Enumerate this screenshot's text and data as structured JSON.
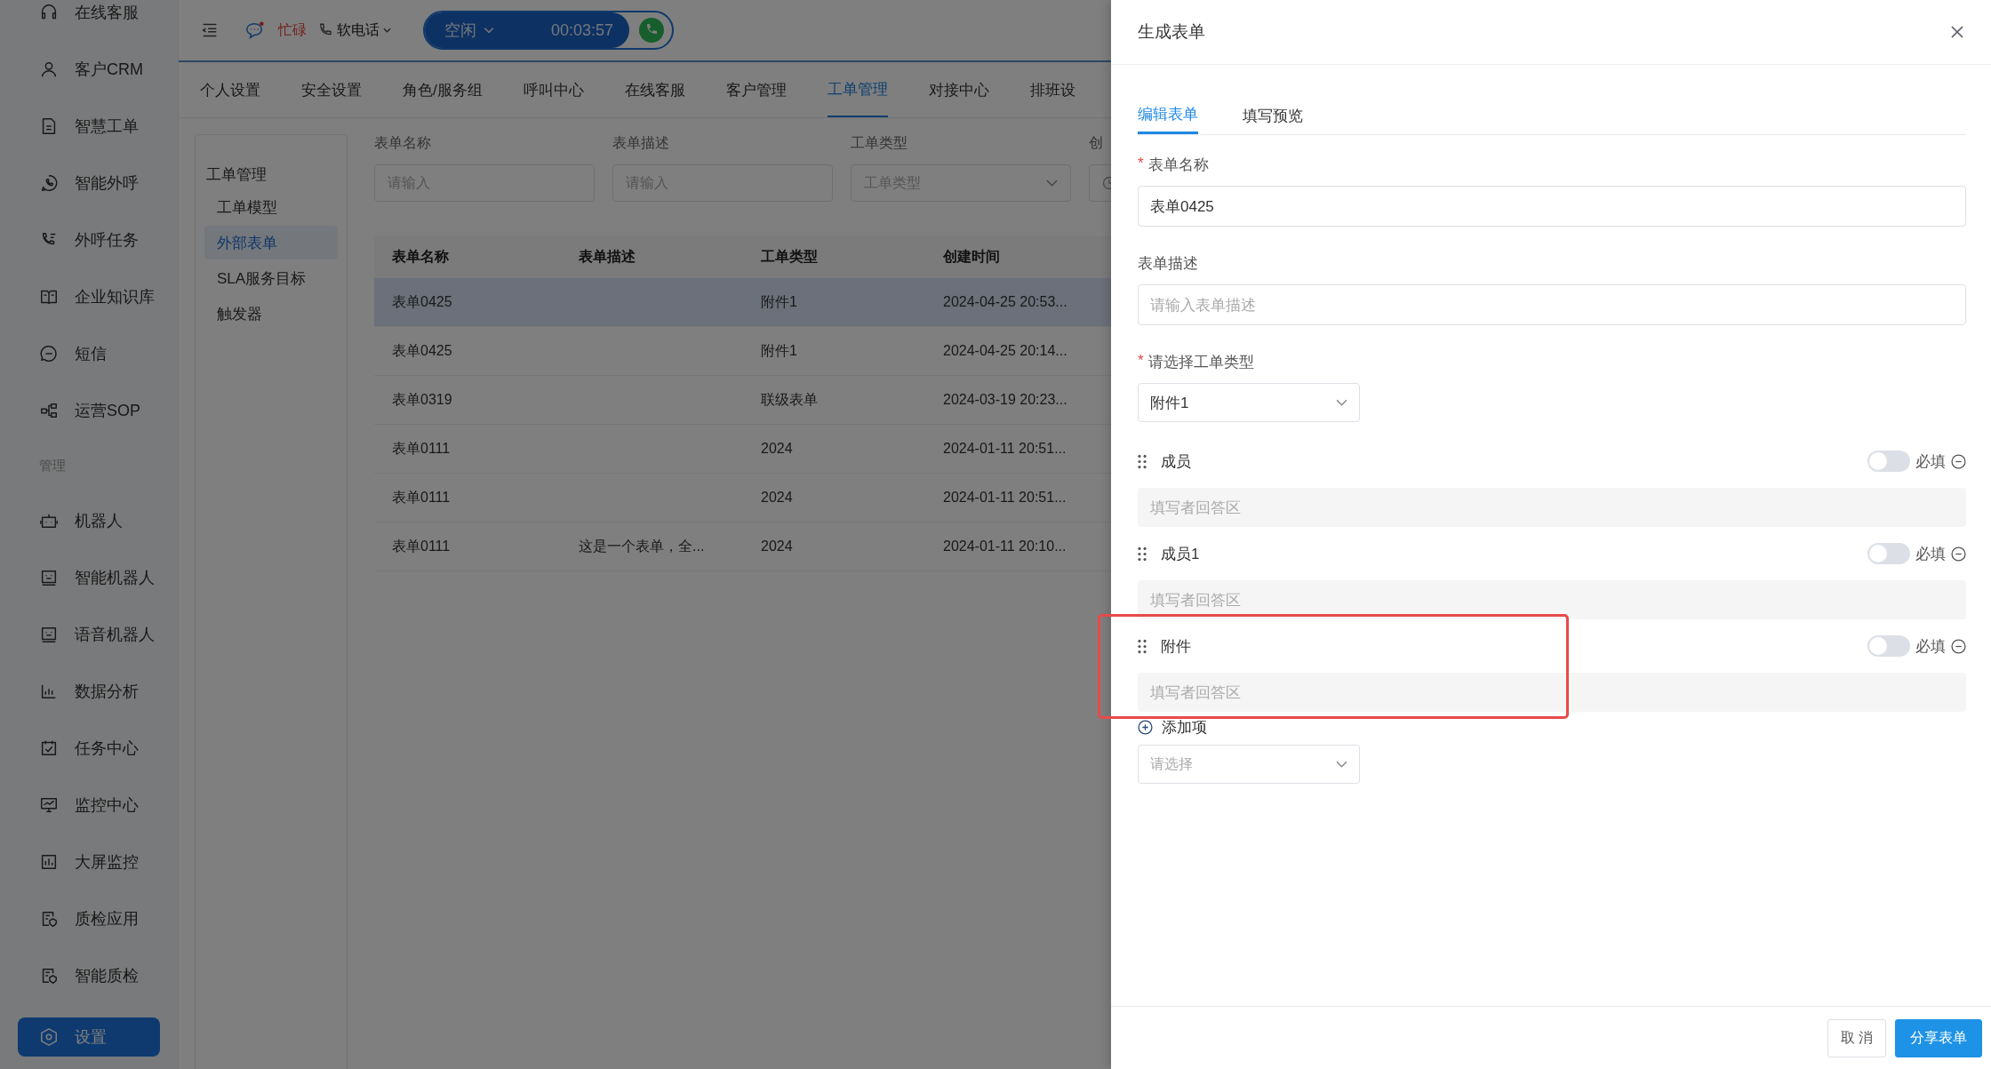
{
  "sidebar": {
    "items": [
      {
        "label": "在线客服",
        "selected": false
      },
      {
        "label": "客户CRM",
        "selected": false
      },
      {
        "label": "智慧工单",
        "selected": false
      },
      {
        "label": "智能外呼",
        "selected": false
      },
      {
        "label": "外呼任务",
        "selected": false
      },
      {
        "label": "企业知识库",
        "selected": false
      },
      {
        "label": "短信",
        "selected": false
      },
      {
        "label": "运营SOP",
        "selected": false
      }
    ],
    "section": "管理",
    "admin_items": [
      {
        "label": "机器人",
        "selected": false
      },
      {
        "label": "智能机器人",
        "selected": false
      },
      {
        "label": "语音机器人",
        "selected": false
      },
      {
        "label": "数据分析",
        "selected": false
      },
      {
        "label": "任务中心",
        "selected": false
      },
      {
        "label": "监控中心",
        "selected": false
      },
      {
        "label": "大屏监控",
        "selected": false
      },
      {
        "label": "质检应用",
        "selected": false
      },
      {
        "label": "智能质检",
        "selected": false
      },
      {
        "label": "设置",
        "selected": true
      }
    ]
  },
  "top_bar": {
    "status": "忙碌",
    "softphone": "软电话",
    "call_state": "空闲",
    "timer": "00:03:57"
  },
  "settings_tabs": [
    {
      "label": "个人设置",
      "selected": false
    },
    {
      "label": "安全设置",
      "selected": false
    },
    {
      "label": "角色/服务组",
      "selected": false
    },
    {
      "label": "呼叫中心",
      "selected": false
    },
    {
      "label": "在线客服",
      "selected": false
    },
    {
      "label": "客户管理",
      "selected": false
    },
    {
      "label": "工单管理",
      "selected": true
    },
    {
      "label": "对接中心",
      "selected": false
    },
    {
      "label": "排班设",
      "selected": false
    }
  ],
  "subnav": {
    "title": "工单管理",
    "items": [
      {
        "label": "工单模型",
        "selected": false
      },
      {
        "label": "外部表单",
        "selected": true
      },
      {
        "label": "SLA服务目标",
        "selected": false
      },
      {
        "label": "触发器",
        "selected": false
      }
    ]
  },
  "filters": [
    {
      "kind": "input",
      "label": "表单名称",
      "placeholder": "请输入"
    },
    {
      "kind": "input",
      "label": "表单描述",
      "placeholder": "请输入"
    },
    {
      "kind": "select",
      "label": "工单类型",
      "placeholder": "工单类型"
    },
    {
      "kind": "date",
      "label": "创"
    }
  ],
  "table": {
    "columns": [
      "表单名称",
      "表单描述",
      "工单类型",
      "创建时间"
    ],
    "rows": [
      {
        "selected": true,
        "cells": [
          "表单0425",
          "",
          "附件1",
          "2024-04-25 20:53..."
        ]
      },
      {
        "selected": false,
        "cells": [
          "表单0425",
          "",
          "附件1",
          "2024-04-25 20:14..."
        ]
      },
      {
        "selected": false,
        "cells": [
          "表单0319",
          "",
          "联级表单",
          "2024-03-19 20:23..."
        ]
      },
      {
        "selected": false,
        "cells": [
          "表单0111",
          "",
          "2024",
          "2024-01-11 20:51..."
        ]
      },
      {
        "selected": false,
        "cells": [
          "表单0111",
          "",
          "2024",
          "2024-01-11 20:51..."
        ]
      },
      {
        "selected": false,
        "cells": [
          "表单0111",
          "这是一个表单，全...",
          "2024",
          "2024-01-11 20:10..."
        ]
      }
    ]
  },
  "drawer": {
    "title": "生成表单",
    "required_mark": "*",
    "tabs": [
      {
        "label": "编辑表单",
        "selected": true
      },
      {
        "label": "填写预览",
        "selected": false
      }
    ],
    "name": {
      "label": "表单名称",
      "required": true,
      "value": "表单0425"
    },
    "description": {
      "label": "表单描述",
      "required": false,
      "placeholder": "请输入表单描述"
    },
    "type": {
      "label": "请选择工单类型",
      "required": true,
      "value": "附件1"
    },
    "items": [
      {
        "label": "成员",
        "required": false,
        "required_label": "必填",
        "answer_placeholder": "填写者回答区",
        "highlighted": false
      },
      {
        "label": "成员1",
        "required": false,
        "required_label": "必填",
        "answer_placeholder": "填写者回答区",
        "highlighted": false
      },
      {
        "label": "附件",
        "required": false,
        "required_label": "必填",
        "answer_placeholder": "填写者回答区",
        "highlighted": true
      }
    ],
    "add_label": "添加项",
    "add_select": {
      "placeholder": "请选择"
    },
    "buttons": [
      {
        "kind": "default",
        "label": "取 消"
      },
      {
        "kind": "primary",
        "label": "分享表单"
      }
    ]
  }
}
